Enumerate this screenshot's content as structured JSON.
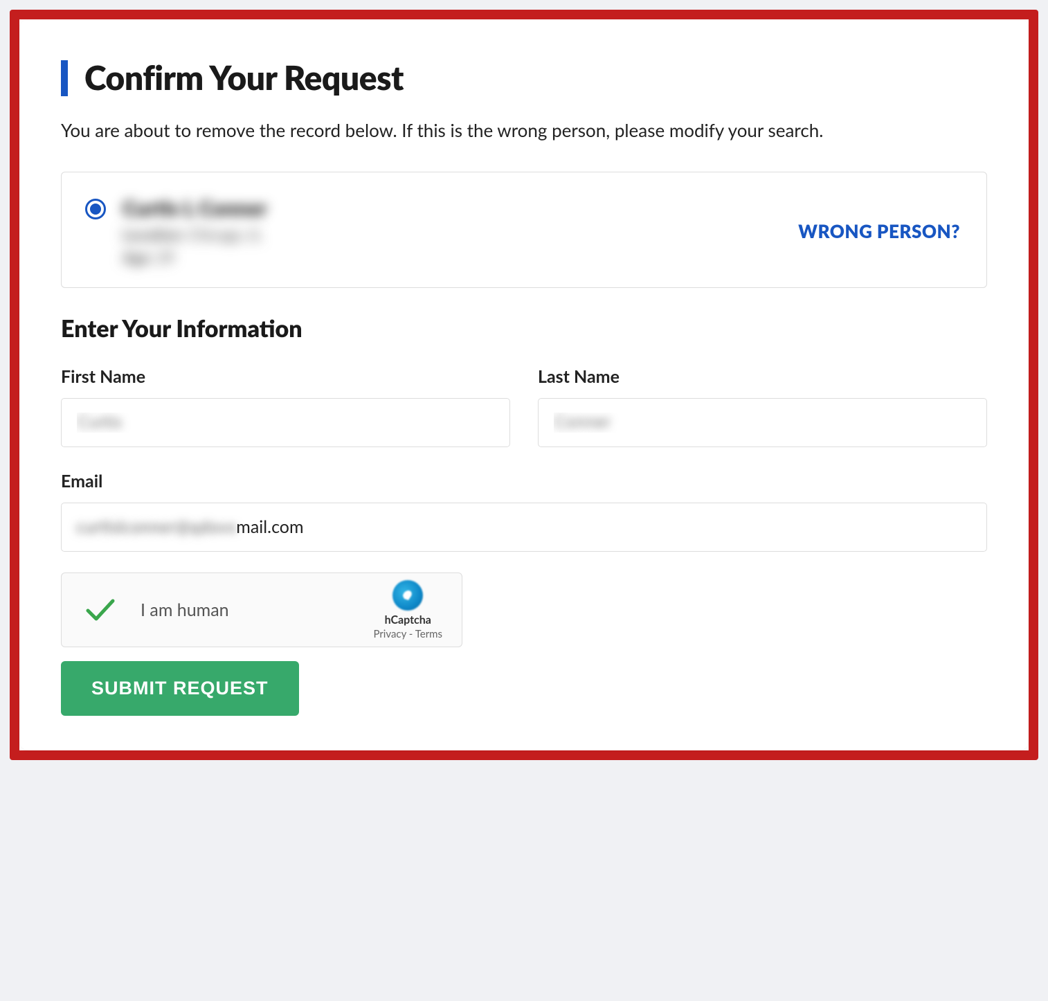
{
  "header": {
    "title": "Confirm Your Request",
    "subtitle": "You are about to remove the record below. If this is the wrong person, please modify your search."
  },
  "record": {
    "name": "Curtis L Conner",
    "location_label": "Location:",
    "location_value": "Chicago, IL",
    "age_label": "Age:",
    "age_value": "29",
    "wrong_link": "WRONG PERSON?"
  },
  "form": {
    "section_title": "Enter Your Information",
    "first_name_label": "First Name",
    "first_name_value": "Curtis",
    "last_name_label": "Last Name",
    "last_name_value": "Conner",
    "email_label": "Email",
    "email_blurred_part": "curtislconner@qdovx",
    "email_visible_part": "mail.com"
  },
  "captcha": {
    "text": "I am human",
    "brand": "hCaptcha",
    "privacy": "Privacy",
    "terms": "Terms"
  },
  "actions": {
    "submit_label": "SUBMIT REQUEST"
  }
}
